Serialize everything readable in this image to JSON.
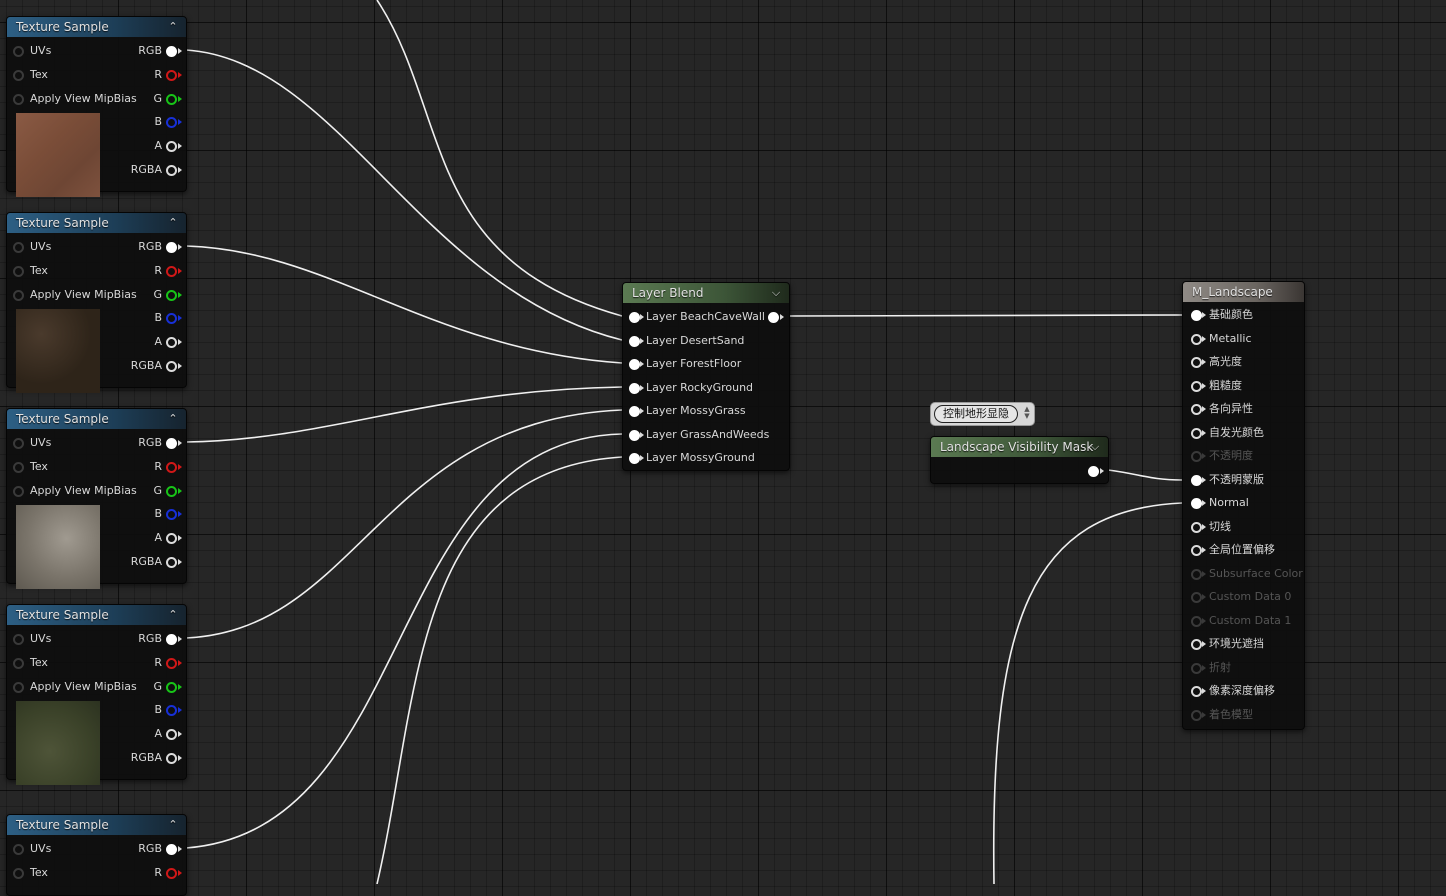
{
  "texture_samples": [
    {
      "title": "Texture Sample",
      "inputs": [
        "UVs",
        "Tex",
        "Apply View MipBias"
      ],
      "outputs": [
        "RGB",
        "R",
        "G",
        "B",
        "A",
        "RGBA"
      ]
    },
    {
      "title": "Texture Sample",
      "inputs": [
        "UVs",
        "Tex",
        "Apply View MipBias"
      ],
      "outputs": [
        "RGB",
        "R",
        "G",
        "B",
        "A",
        "RGBA"
      ]
    },
    {
      "title": "Texture Sample",
      "inputs": [
        "UVs",
        "Tex",
        "Apply View MipBias"
      ],
      "outputs": [
        "RGB",
        "R",
        "G",
        "B",
        "A",
        "RGBA"
      ]
    },
    {
      "title": "Texture Sample",
      "inputs": [
        "UVs",
        "Tex",
        "Apply View MipBias"
      ],
      "outputs": [
        "RGB",
        "R",
        "G",
        "B",
        "A",
        "RGBA"
      ]
    },
    {
      "title": "Texture Sample",
      "inputs": [
        "UVs",
        "Tex"
      ],
      "outputs": [
        "RGB",
        "R"
      ]
    }
  ],
  "layer_blend": {
    "title": "Layer Blend",
    "layers": [
      "Layer BeachCaveWall",
      "Layer DesertSand",
      "Layer ForestFloor",
      "Layer RockyGround",
      "Layer MossyGrass",
      "Layer GrassAndWeeds",
      "Layer MossyGround"
    ]
  },
  "comment": {
    "text": "控制地形显隐"
  },
  "visibility_mask": {
    "title": "Landscape Visibility Mask"
  },
  "material": {
    "title": "M_Landscape",
    "pins": [
      {
        "label": "基础颜色",
        "state": "connected"
      },
      {
        "label": "Metallic",
        "state": "active"
      },
      {
        "label": "高光度",
        "state": "active"
      },
      {
        "label": "粗糙度",
        "state": "active"
      },
      {
        "label": "各向异性",
        "state": "active"
      },
      {
        "label": "自发光颜色",
        "state": "active"
      },
      {
        "label": "不透明度",
        "state": "disabled"
      },
      {
        "label": "不透明蒙版",
        "state": "connected"
      },
      {
        "label": "Normal",
        "state": "connected"
      },
      {
        "label": "切线",
        "state": "active"
      },
      {
        "label": "全局位置偏移",
        "state": "active"
      },
      {
        "label": "Subsurface Color",
        "state": "disabled"
      },
      {
        "label": "Custom Data 0",
        "state": "disabled"
      },
      {
        "label": "Custom Data 1",
        "state": "disabled"
      },
      {
        "label": "环境光遮挡",
        "state": "active"
      },
      {
        "label": "折射",
        "state": "disabled"
      },
      {
        "label": "像素深度偏移",
        "state": "active"
      },
      {
        "label": "着色模型",
        "state": "disabled"
      }
    ]
  },
  "colors": {
    "grid_bg": "#262626",
    "wire": "#f0f0f0",
    "pin_r": "#d01818",
    "pin_g": "#18c418",
    "pin_b": "#1830d8"
  },
  "thumbnails": [
    "red-brown cave wall texture",
    "dark forest floor texture",
    "grey rocky ground texture",
    "mossy green grass texture"
  ]
}
